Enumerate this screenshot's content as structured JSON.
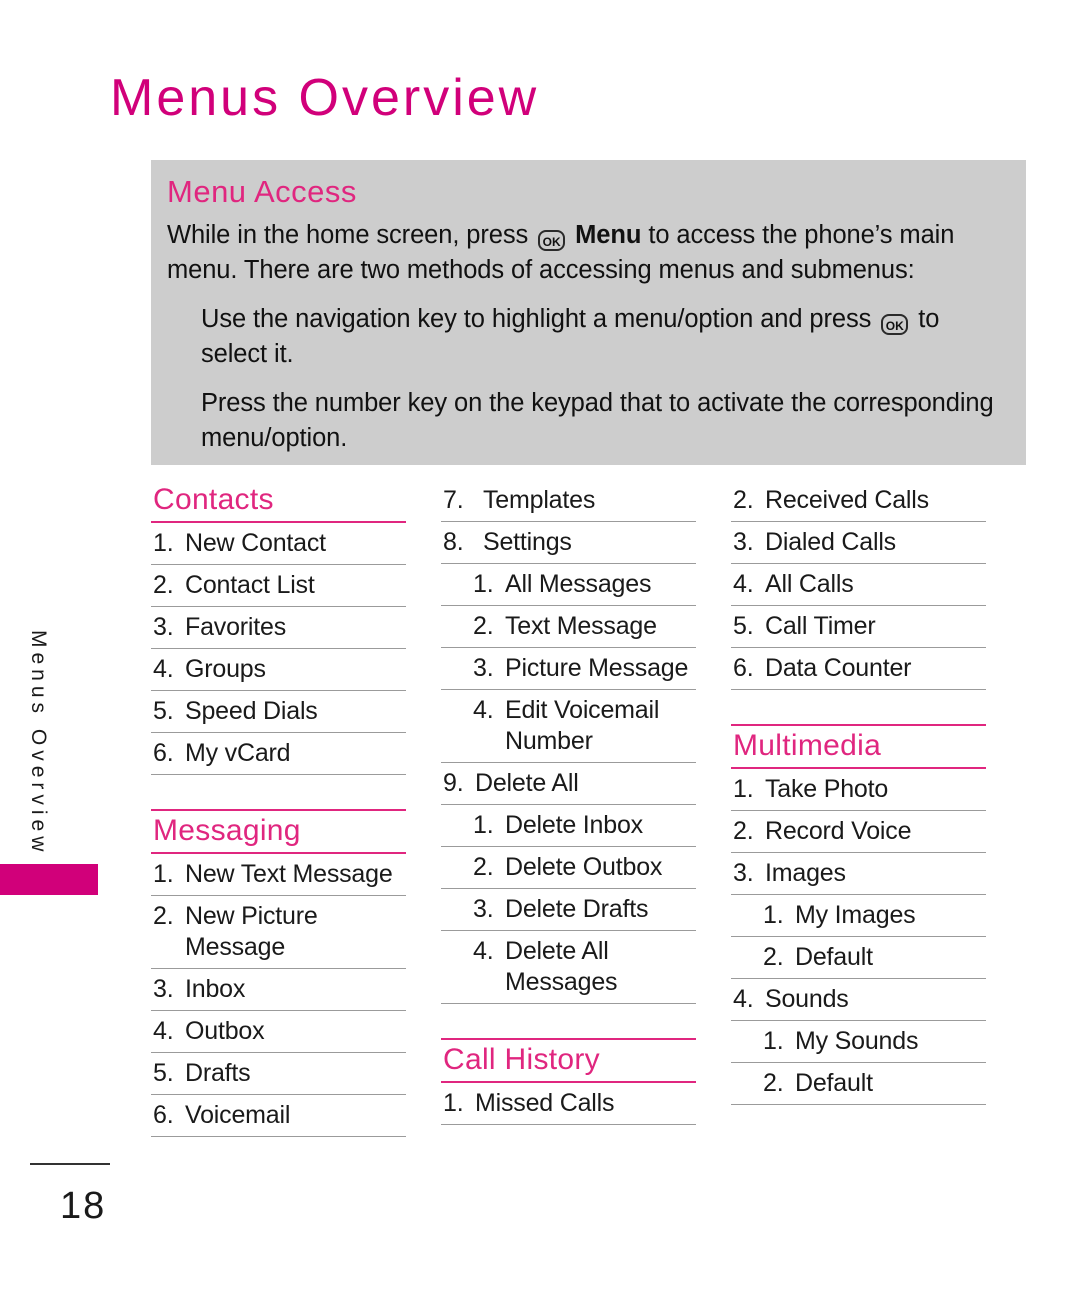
{
  "page": {
    "title": "Menus Overview",
    "running_head": "Menus Overview",
    "page_number": "18",
    "accent_color": "#D1007A",
    "box_color": "#CDCDCD"
  },
  "menu_access": {
    "heading": "Menu Access",
    "ok_icon_label": "OK",
    "para1_before": "While in the home screen, press",
    "para1_bold": "Menu",
    "para1_after": "to access the phone’s main menu. There are two methods of accessing menus and submenus:",
    "para2_before": "Use the navigation key to highlight a menu/option and press",
    "para2_after": "to select it.",
    "para3": "Press the number key on the keypad that to activate the corresponding menu/option."
  },
  "columns": [
    {
      "sections": [
        {
          "heading": "Contacts",
          "topline": false,
          "items": [
            {
              "num": "1.",
              "text": "New Contact",
              "sub": false
            },
            {
              "num": "2.",
              "text": "Contact List",
              "sub": false
            },
            {
              "num": "3.",
              "text": "Favorites",
              "sub": false
            },
            {
              "num": "4.",
              "text": "Groups",
              "sub": false
            },
            {
              "num": "5.",
              "text": "Speed Dials",
              "sub": false
            },
            {
              "num": "6.",
              "text": "My vCard",
              "sub": false
            }
          ]
        },
        {
          "heading": "Messaging",
          "topline": true,
          "items": [
            {
              "num": "1.",
              "text": "New Text Message",
              "sub": false
            },
            {
              "num": "2.",
              "text": "New Picture Message",
              "sub": false
            },
            {
              "num": "3.",
              "text": "Inbox",
              "sub": false
            },
            {
              "num": "4.",
              "text": "Outbox",
              "sub": false
            },
            {
              "num": "5.",
              "text": "Drafts",
              "sub": false
            },
            {
              "num": "6.",
              "text": "Voicemail",
              "sub": false
            }
          ]
        }
      ]
    },
    {
      "sections": [
        {
          "heading": null,
          "topline": false,
          "items": [
            {
              "num": "7.",
              "text": "Templates",
              "sub": false,
              "wide": true
            },
            {
              "num": "8.",
              "text": "Settings",
              "sub": false,
              "wide": true
            },
            {
              "num": "1.",
              "text": "All Messages",
              "sub": true
            },
            {
              "num": "2.",
              "text": "Text Message",
              "sub": true
            },
            {
              "num": "3.",
              "text": "Picture Message",
              "sub": true
            },
            {
              "num": "4.",
              "text": "Edit Voicemail Number",
              "sub": true
            },
            {
              "num": "9.",
              "text": "Delete All",
              "sub": false
            },
            {
              "num": "1.",
              "text": "Delete Inbox",
              "sub": true
            },
            {
              "num": "2.",
              "text": "Delete Outbox",
              "sub": true
            },
            {
              "num": "3.",
              "text": "Delete Drafts",
              "sub": true
            },
            {
              "num": "4.",
              "text": "Delete All Messages",
              "sub": true
            }
          ]
        },
        {
          "heading": "Call History",
          "topline": true,
          "items": [
            {
              "num": "1.",
              "text": "Missed Calls",
              "sub": false
            }
          ]
        }
      ]
    },
    {
      "sections": [
        {
          "heading": null,
          "topline": false,
          "items": [
            {
              "num": "2.",
              "text": "Received Calls",
              "sub": false
            },
            {
              "num": "3.",
              "text": "Dialed Calls",
              "sub": false
            },
            {
              "num": "4.",
              "text": "All Calls",
              "sub": false
            },
            {
              "num": "5.",
              "text": "Call Timer",
              "sub": false
            },
            {
              "num": "6.",
              "text": "Data Counter",
              "sub": false
            }
          ]
        },
        {
          "heading": "Multimedia",
          "topline": true,
          "items": [
            {
              "num": "1.",
              "text": "Take Photo",
              "sub": false
            },
            {
              "num": "2.",
              "text": "Record Voice",
              "sub": false
            },
            {
              "num": "3.",
              "text": "Images",
              "sub": false
            },
            {
              "num": "1.",
              "text": "My Images",
              "sub": true
            },
            {
              "num": "2.",
              "text": "Default",
              "sub": true
            },
            {
              "num": "4.",
              "text": "Sounds",
              "sub": false
            },
            {
              "num": "1.",
              "text": "My Sounds",
              "sub": true
            },
            {
              "num": "2.",
              "text": "Default",
              "sub": true
            }
          ]
        }
      ]
    }
  ]
}
